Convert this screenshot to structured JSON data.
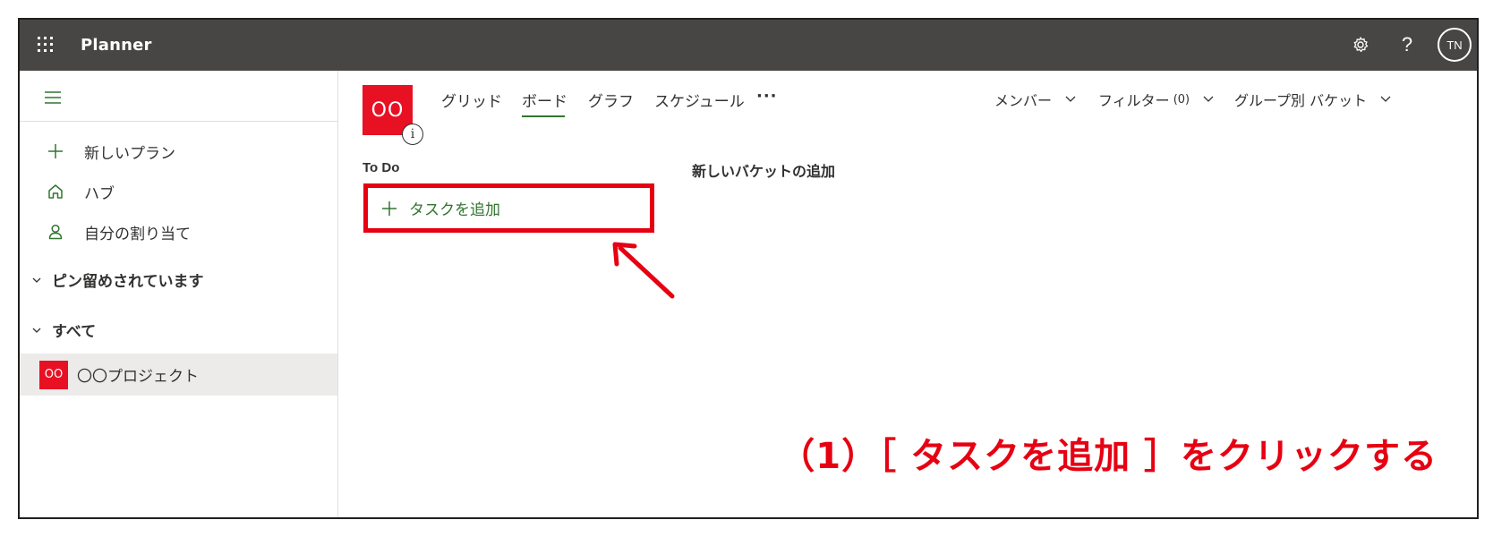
{
  "topbar": {
    "app_name": "Planner",
    "waffle_icon": "app-launcher-icon",
    "settings_icon": "gear-icon",
    "help_label": "?",
    "avatar_initials": "TN",
    "background_color": "#474645"
  },
  "sidebar": {
    "menu_icon": "hamburger-icon",
    "nav_items": [
      {
        "label": "新しいプラン",
        "icon": "plus-icon"
      },
      {
        "label": "ハブ",
        "icon": "home-icon"
      },
      {
        "label": "自分の割り当て",
        "icon": "person-icon"
      }
    ],
    "sections": [
      {
        "label": "ピン留めされています"
      },
      {
        "label": "すべて"
      }
    ],
    "plans": [
      {
        "thumb": "OO",
        "name": "〇〇プロジェクト"
      }
    ]
  },
  "main": {
    "plan_logo_text": "OO",
    "info_label": "i",
    "tabs": [
      {
        "label": "グリッド"
      },
      {
        "label": "ボード",
        "active": true
      },
      {
        "label": "グラフ"
      },
      {
        "label": "スケジュール"
      }
    ],
    "more_label": "···",
    "controls": {
      "members": "メンバー",
      "filter": "フィルター",
      "filter_count": "(0)",
      "group_by": "グループ別 バケット"
    },
    "bucket": {
      "title": "To Do",
      "add_task_label": "タスクを追加"
    },
    "new_bucket_label": "新しいバケットの追加"
  },
  "annotation": {
    "instruction": "（1）［ タスクを追加 ］をクリックする",
    "color": "#e60012"
  },
  "colors": {
    "accent_green": "#31752f",
    "plan_red": "#e81123"
  }
}
